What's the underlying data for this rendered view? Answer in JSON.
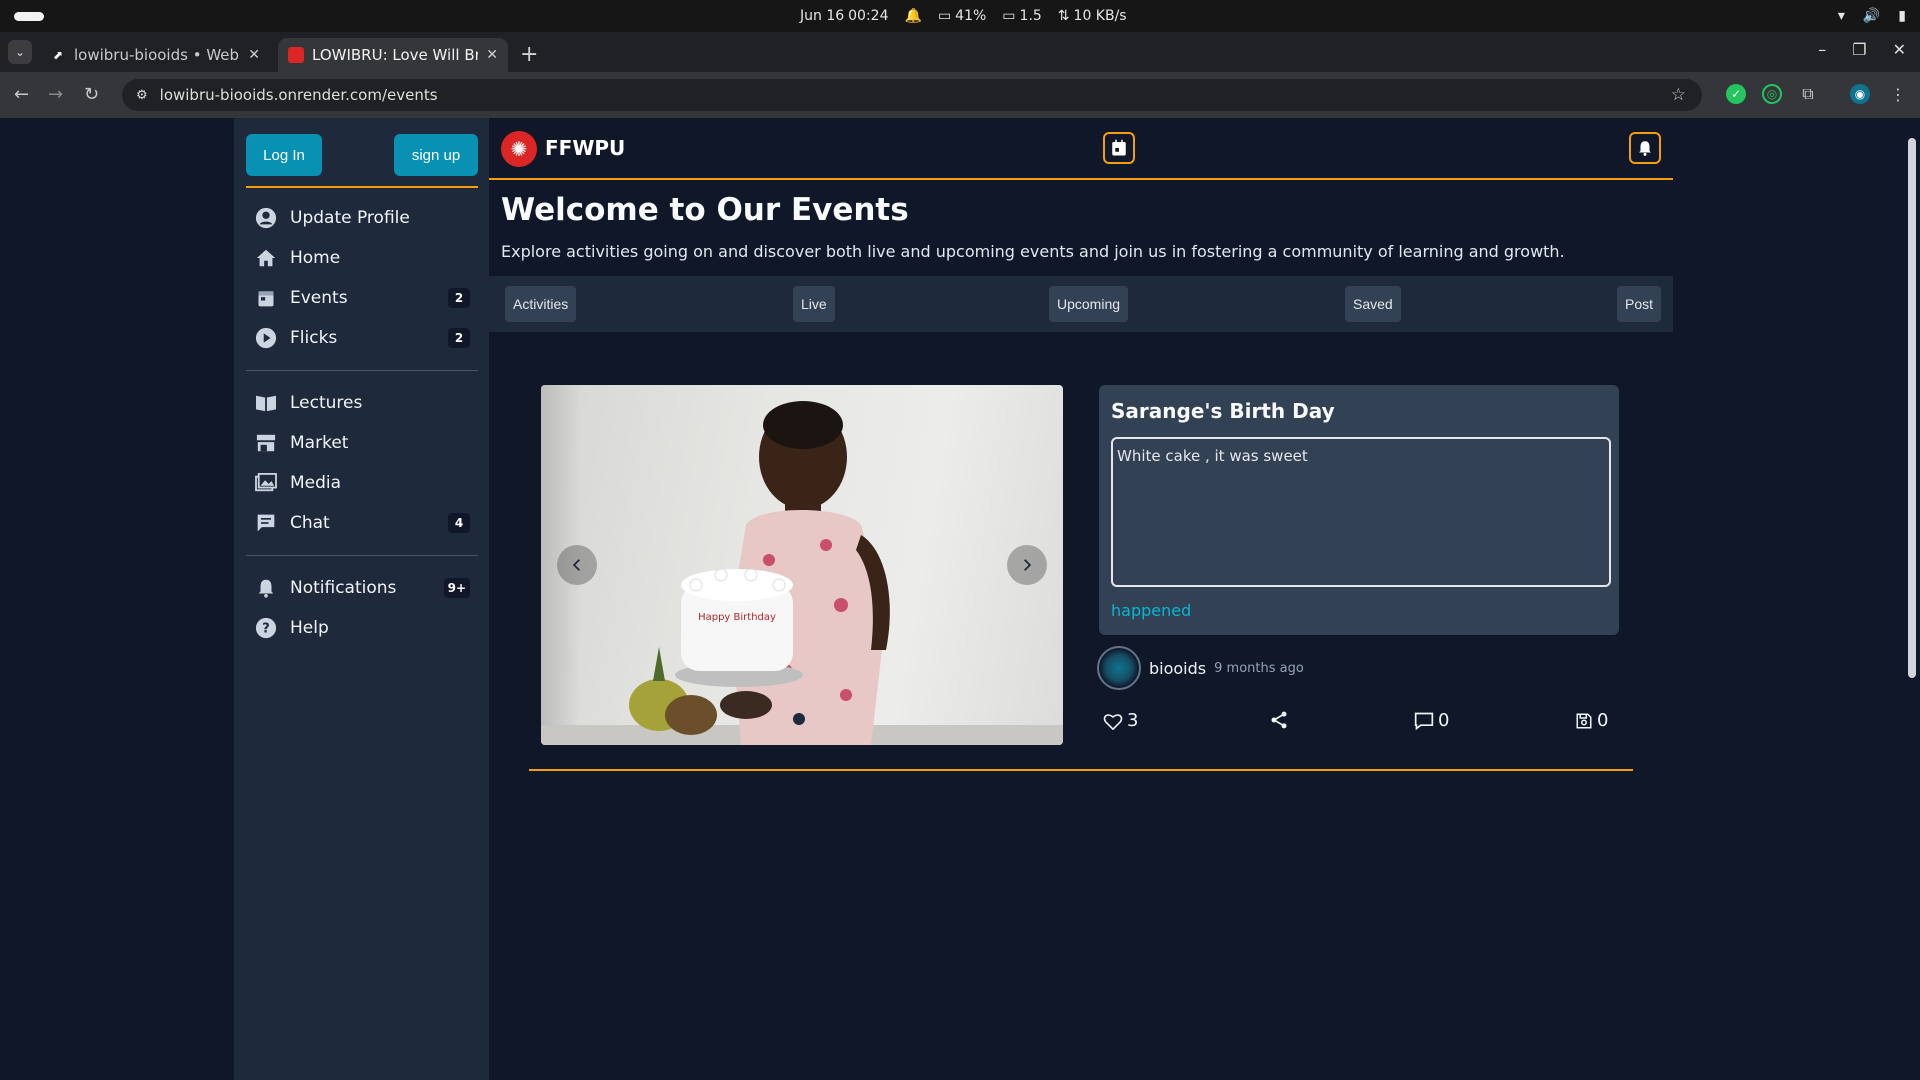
{
  "os": {
    "date": "Jun 16",
    "time": "00:24",
    "battery": "41%",
    "display_scale": "1.5",
    "net_speed": "10 KB/s"
  },
  "browser": {
    "tabs": [
      {
        "title": "lowibru-biooids • Web S",
        "active": false
      },
      {
        "title": "LOWIBRU: Love Will Brin",
        "active": true
      }
    ],
    "url": "lowibru-biooids.onrender.com/events"
  },
  "sidebar": {
    "login_label": "Log In",
    "signup_label": "sign up",
    "items": [
      {
        "label": "Update Profile",
        "icon": "user-circle-icon",
        "badge": ""
      },
      {
        "label": "Home",
        "icon": "home-icon",
        "badge": ""
      },
      {
        "label": "Events",
        "icon": "calendar-icon",
        "badge": "2"
      },
      {
        "label": "Flicks",
        "icon": "play-circle-icon",
        "badge": "2"
      }
    ],
    "items2": [
      {
        "label": "Lectures",
        "icon": "book-icon",
        "badge": ""
      },
      {
        "label": "Market",
        "icon": "store-icon",
        "badge": ""
      },
      {
        "label": "Media",
        "icon": "images-icon",
        "badge": ""
      },
      {
        "label": "Chat",
        "icon": "chat-icon",
        "badge": "4"
      }
    ],
    "items3": [
      {
        "label": "Notifications",
        "icon": "bell-icon",
        "badge": "9+"
      },
      {
        "label": "Help",
        "icon": "help-icon",
        "badge": ""
      }
    ]
  },
  "header": {
    "brand": "FFWPU"
  },
  "main": {
    "title": "Welcome to Our Events",
    "subtitle": "Explore activities going on and discover both live and upcoming events and join us in fostering a community of learning and growth.",
    "tabs": [
      "Activities",
      "Live",
      "Upcoming",
      "Saved",
      "Post"
    ]
  },
  "event": {
    "title": "Sarange's Birth Day",
    "description": "White cake , it was sweet",
    "status": "happened",
    "author": "biooids",
    "time_ago": "9 months ago",
    "likes": "3",
    "comments": "0",
    "saves": "0",
    "cake_text": "Happy Birthday"
  },
  "colors": {
    "accent": "#f59e0b",
    "primary": "#0891b2",
    "background": "#0f1729",
    "panel": "#1e293b"
  }
}
